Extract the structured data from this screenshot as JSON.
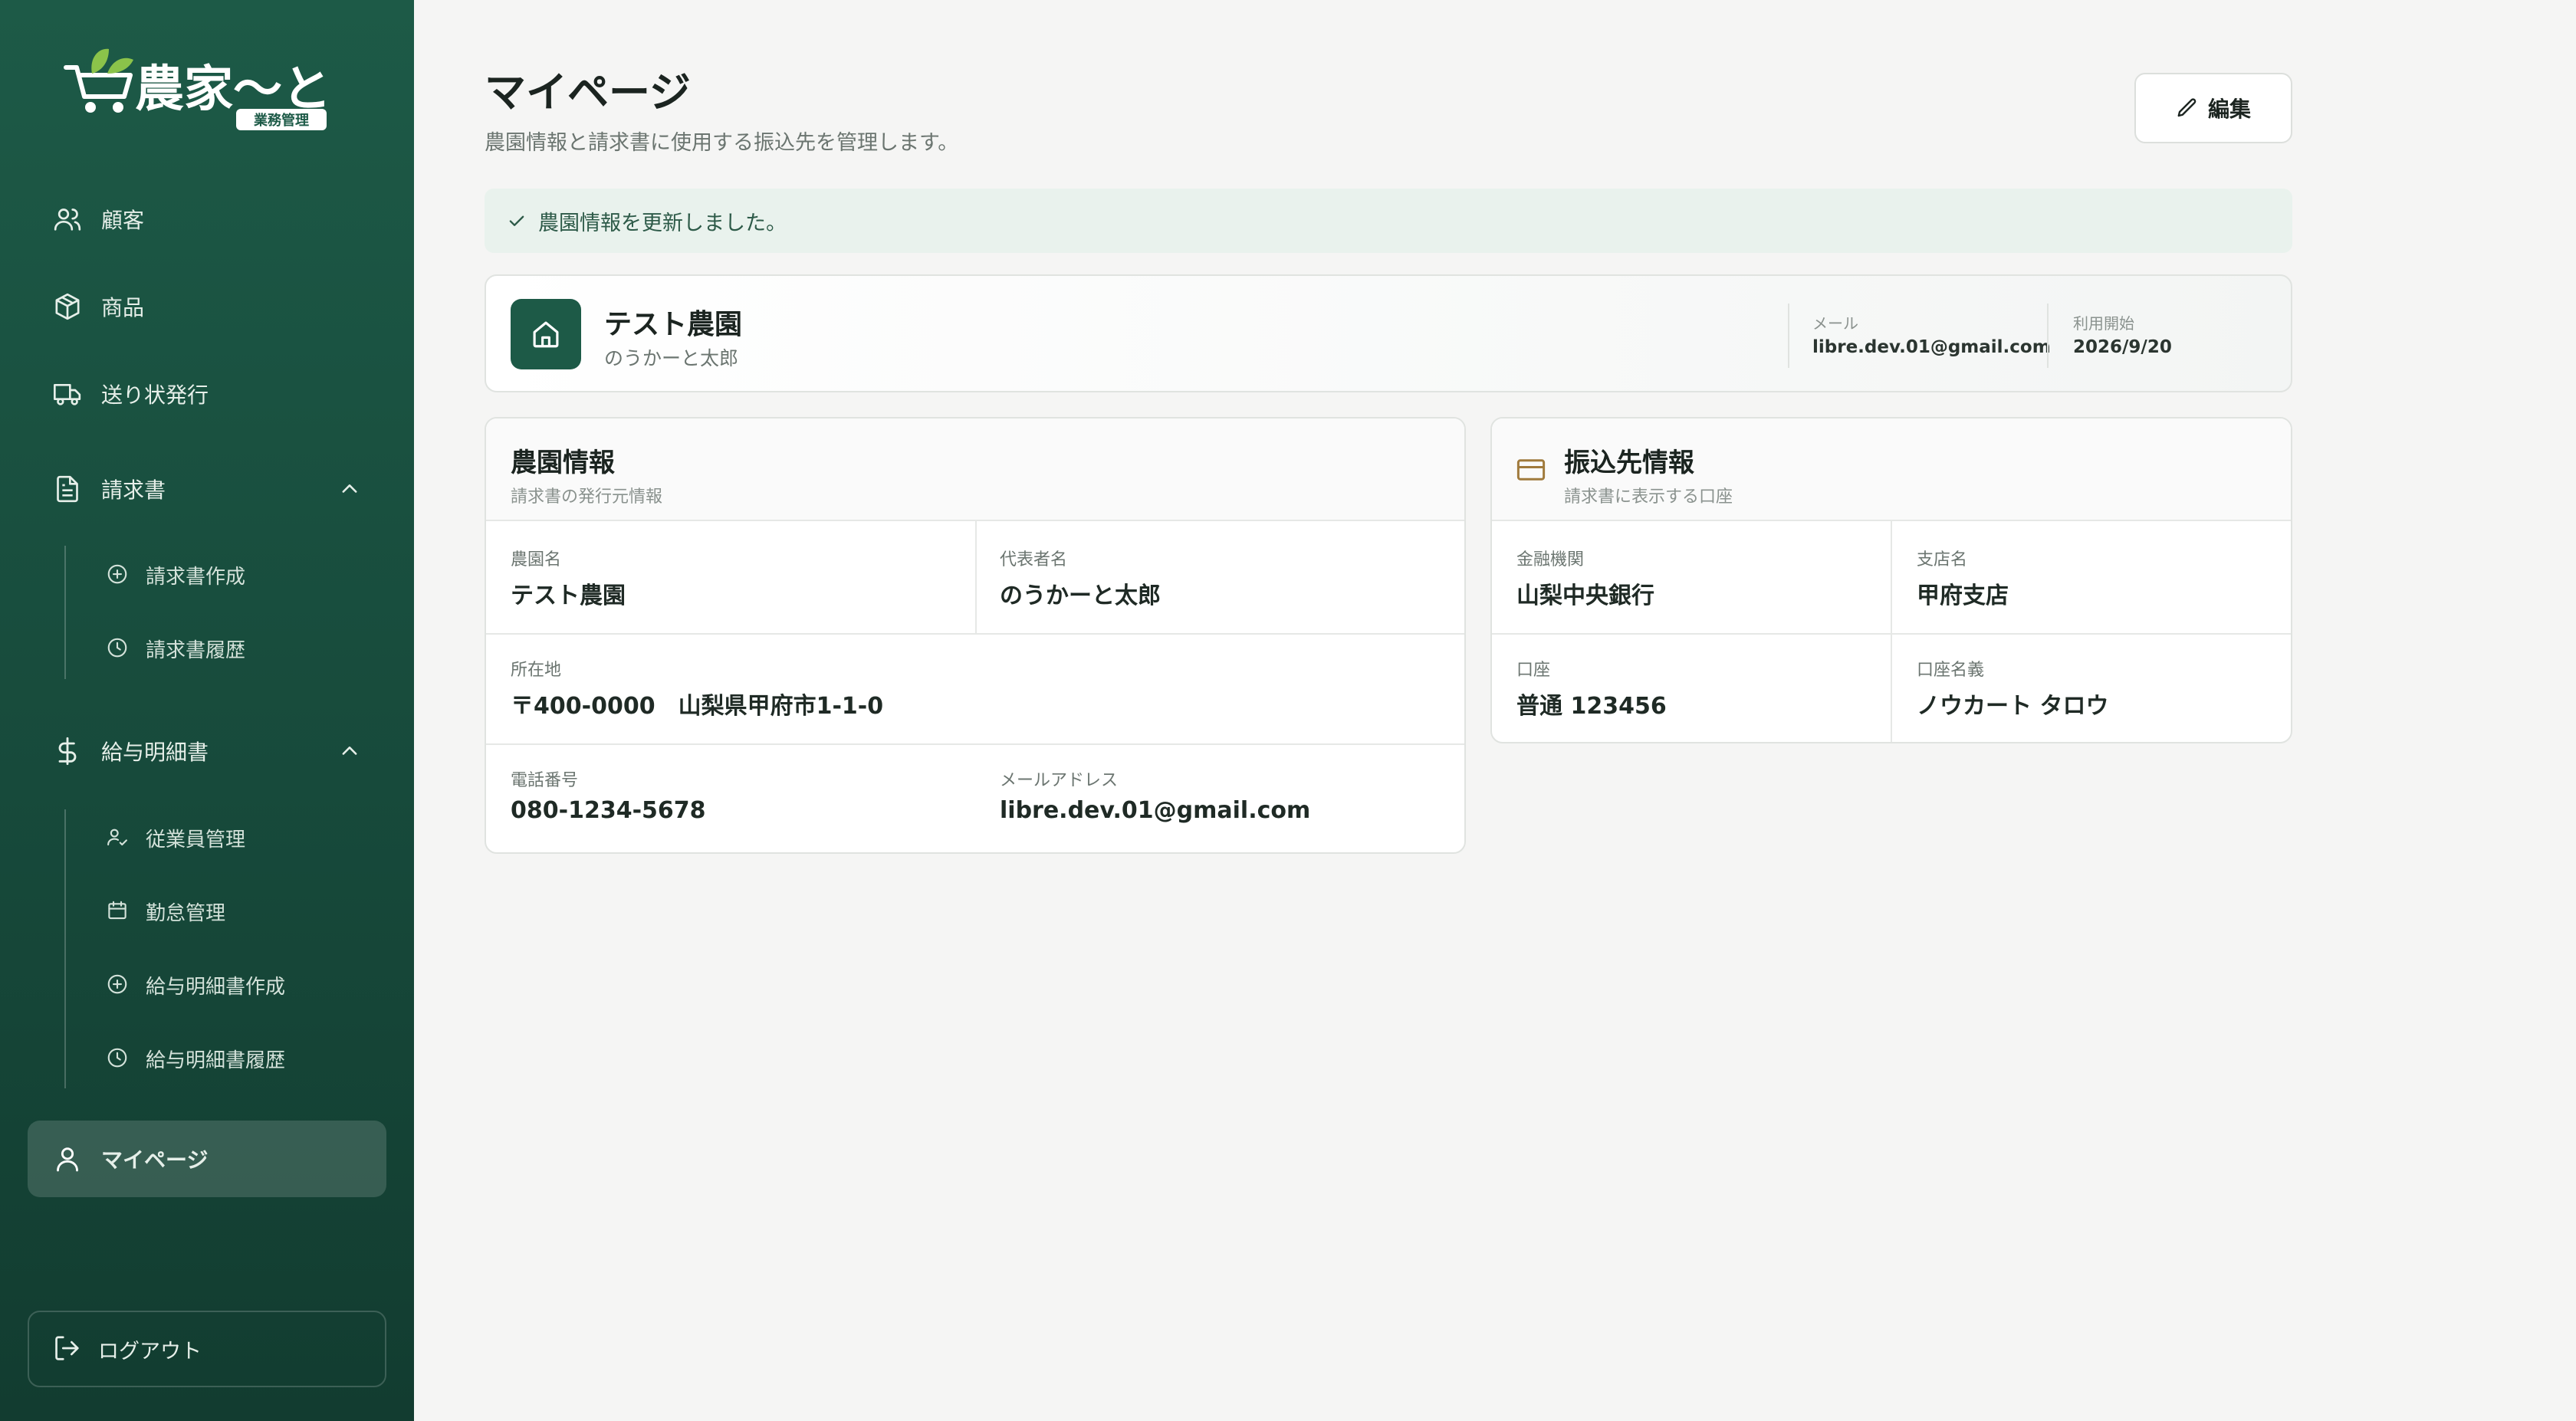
{
  "app": {
    "logo_text": "農家〜と",
    "logo_badge": "業務管理"
  },
  "sidebar": {
    "items": [
      {
        "label": "顧客",
        "icon": "users-icon"
      },
      {
        "label": "商品",
        "icon": "package-icon"
      },
      {
        "label": "送り状発行",
        "icon": "truck-icon"
      },
      {
        "label": "請求書",
        "icon": "file-text-icon",
        "expanded": true,
        "children": [
          {
            "label": "請求書作成",
            "icon": "plus-circle-icon"
          },
          {
            "label": "請求書履歴",
            "icon": "clock-icon"
          }
        ]
      },
      {
        "label": "給与明細書",
        "icon": "dollar-icon",
        "expanded": true,
        "children": [
          {
            "label": "従業員管理",
            "icon": "user-check-icon"
          },
          {
            "label": "勤怠管理",
            "icon": "calendar-icon"
          },
          {
            "label": "給与明細書作成",
            "icon": "plus-circle-icon"
          },
          {
            "label": "給与明細書履歴",
            "icon": "clock-icon"
          }
        ]
      },
      {
        "label": "マイページ",
        "icon": "user-icon",
        "active": true
      }
    ],
    "logout_label": "ログアウト"
  },
  "header": {
    "title": "マイページ",
    "subtitle": "農園情報と請求書に使用する振込先を管理します。",
    "edit_label": "編集"
  },
  "alert": {
    "message": "農園情報を更新しました。"
  },
  "profile": {
    "farm_name": "テスト農園",
    "owner": "のうかーと太郎",
    "email_label": "メール",
    "email": "libre.dev.01@gmail.com",
    "start_label": "利用開始",
    "start_date": "2026/9/20"
  },
  "farm_info": {
    "title": "農園情報",
    "subtitle": "請求書の発行元情報",
    "fields": {
      "farm_name_label": "農園名",
      "farm_name": "テスト農園",
      "rep_label": "代表者名",
      "rep": "のうかーと太郎",
      "address_label": "所在地",
      "address": "〒400-0000　山梨県甲府市1-1-0",
      "phone_label": "電話番号",
      "phone": "080-1234-5678",
      "mail_label": "メールアドレス",
      "mail": "libre.dev.01@gmail.com"
    }
  },
  "bank_info": {
    "title": "振込先情報",
    "subtitle": "請求書に表示する口座",
    "fields": {
      "bank_label": "金融機関",
      "bank": "山梨中央銀行",
      "branch_label": "支店名",
      "branch": "甲府支店",
      "account_label": "口座",
      "account": "普通 123456",
      "holder_label": "口座名義",
      "holder": "ノウカート タロウ"
    }
  },
  "colors": {
    "sidebar": "#1d5a47",
    "accent": "#1d5a47",
    "alert_bg": "#e9f2ed",
    "bank_icon": "#a07a3c"
  }
}
